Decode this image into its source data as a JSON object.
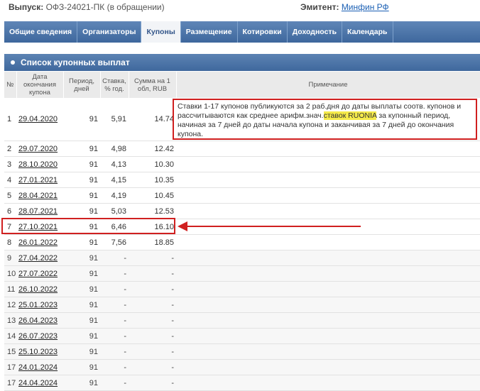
{
  "header": {
    "issue_label": "Выпуск:",
    "issue_value": "ОФЗ-24021-ПК (в обращении)",
    "issuer_label": "Эмитент:",
    "issuer_link": "Минфин РФ"
  },
  "nav": {
    "tabs": [
      {
        "label": "Общие сведения",
        "active": false
      },
      {
        "label": "Организаторы",
        "active": false
      },
      {
        "label": "Купоны",
        "active": true
      },
      {
        "label": "Размещение",
        "active": false
      },
      {
        "label": "Котировки",
        "active": false
      },
      {
        "label": "Доходность",
        "active": false
      },
      {
        "label": "Календарь",
        "active": false
      }
    ]
  },
  "section": {
    "title": "Список купонных выплат"
  },
  "table": {
    "headers": {
      "num": "№",
      "date": "Дата окончания купона",
      "period": "Период, дней",
      "rate": "Ставка, % год.",
      "amount": "Сумма на 1 обл, RUB",
      "note": "Примечание"
    },
    "rows": [
      {
        "n": "1",
        "date": "29.04.2020",
        "period": "91",
        "rate": "5,91",
        "amount": "14.74"
      },
      {
        "n": "2",
        "date": "29.07.2020",
        "period": "91",
        "rate": "4,98",
        "amount": "12.42"
      },
      {
        "n": "3",
        "date": "28.10.2020",
        "period": "91",
        "rate": "4,13",
        "amount": "10.30"
      },
      {
        "n": "4",
        "date": "27.01.2021",
        "period": "91",
        "rate": "4,15",
        "amount": "10.35"
      },
      {
        "n": "5",
        "date": "28.04.2021",
        "period": "91",
        "rate": "4,19",
        "amount": "10.45"
      },
      {
        "n": "6",
        "date": "28.07.2021",
        "period": "91",
        "rate": "5,03",
        "amount": "12.53"
      },
      {
        "n": "7",
        "date": "27.10.2021",
        "period": "91",
        "rate": "6,46",
        "amount": "16.10"
      },
      {
        "n": "8",
        "date": "26.01.2022",
        "period": "91",
        "rate": "7,56",
        "amount": "18.85"
      },
      {
        "n": "9",
        "date": "27.04.2022",
        "period": "91",
        "rate": "-",
        "amount": "-"
      },
      {
        "n": "10",
        "date": "27.07.2022",
        "period": "91",
        "rate": "-",
        "amount": "-"
      },
      {
        "n": "11",
        "date": "26.10.2022",
        "period": "91",
        "rate": "-",
        "amount": "-"
      },
      {
        "n": "12",
        "date": "25.01.2023",
        "period": "91",
        "rate": "-",
        "amount": "-"
      },
      {
        "n": "13",
        "date": "26.04.2023",
        "period": "91",
        "rate": "-",
        "amount": "-"
      },
      {
        "n": "14",
        "date": "26.07.2023",
        "period": "91",
        "rate": "-",
        "amount": "-"
      },
      {
        "n": "15",
        "date": "25.10.2023",
        "period": "91",
        "rate": "-",
        "amount": "-"
      },
      {
        "n": "17",
        "date": "24.01.2024",
        "period": "91",
        "rate": "-",
        "amount": "-"
      },
      {
        "n": "17",
        "date": "24.04.2024",
        "period": "91",
        "rate": "-",
        "amount": "-"
      }
    ],
    "note": {
      "before": "Ставки 1-17 купонов публикуются за 2 раб.дня до даты выплаты соотв. купонов и рассчитываются как среднее арифм.знач.",
      "highlight": "ставок RUONIA",
      "after": " за купонный период, начиная за 7 дней до даты начала купона и заканчивая за 7 дней до окончания купона."
    }
  },
  "colors": {
    "nav": "#4a73a8",
    "annotation": "#d02020",
    "highlight": "#f5ea4a"
  }
}
